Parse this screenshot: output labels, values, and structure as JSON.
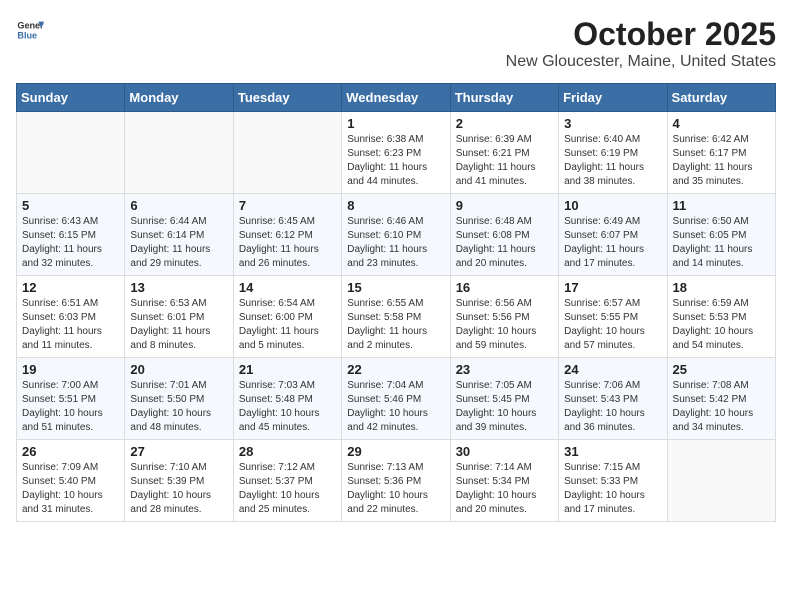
{
  "header": {
    "logo_general": "General",
    "logo_blue": "Blue",
    "title": "October 2025",
    "subtitle": "New Gloucester, Maine, United States"
  },
  "weekdays": [
    "Sunday",
    "Monday",
    "Tuesday",
    "Wednesday",
    "Thursday",
    "Friday",
    "Saturday"
  ],
  "weeks": [
    [
      {
        "day": "",
        "info": ""
      },
      {
        "day": "",
        "info": ""
      },
      {
        "day": "",
        "info": ""
      },
      {
        "day": "1",
        "info": "Sunrise: 6:38 AM\nSunset: 6:23 PM\nDaylight: 11 hours\nand 44 minutes."
      },
      {
        "day": "2",
        "info": "Sunrise: 6:39 AM\nSunset: 6:21 PM\nDaylight: 11 hours\nand 41 minutes."
      },
      {
        "day": "3",
        "info": "Sunrise: 6:40 AM\nSunset: 6:19 PM\nDaylight: 11 hours\nand 38 minutes."
      },
      {
        "day": "4",
        "info": "Sunrise: 6:42 AM\nSunset: 6:17 PM\nDaylight: 11 hours\nand 35 minutes."
      }
    ],
    [
      {
        "day": "5",
        "info": "Sunrise: 6:43 AM\nSunset: 6:15 PM\nDaylight: 11 hours\nand 32 minutes."
      },
      {
        "day": "6",
        "info": "Sunrise: 6:44 AM\nSunset: 6:14 PM\nDaylight: 11 hours\nand 29 minutes."
      },
      {
        "day": "7",
        "info": "Sunrise: 6:45 AM\nSunset: 6:12 PM\nDaylight: 11 hours\nand 26 minutes."
      },
      {
        "day": "8",
        "info": "Sunrise: 6:46 AM\nSunset: 6:10 PM\nDaylight: 11 hours\nand 23 minutes."
      },
      {
        "day": "9",
        "info": "Sunrise: 6:48 AM\nSunset: 6:08 PM\nDaylight: 11 hours\nand 20 minutes."
      },
      {
        "day": "10",
        "info": "Sunrise: 6:49 AM\nSunset: 6:07 PM\nDaylight: 11 hours\nand 17 minutes."
      },
      {
        "day": "11",
        "info": "Sunrise: 6:50 AM\nSunset: 6:05 PM\nDaylight: 11 hours\nand 14 minutes."
      }
    ],
    [
      {
        "day": "12",
        "info": "Sunrise: 6:51 AM\nSunset: 6:03 PM\nDaylight: 11 hours\nand 11 minutes."
      },
      {
        "day": "13",
        "info": "Sunrise: 6:53 AM\nSunset: 6:01 PM\nDaylight: 11 hours\nand 8 minutes."
      },
      {
        "day": "14",
        "info": "Sunrise: 6:54 AM\nSunset: 6:00 PM\nDaylight: 11 hours\nand 5 minutes."
      },
      {
        "day": "15",
        "info": "Sunrise: 6:55 AM\nSunset: 5:58 PM\nDaylight: 11 hours\nand 2 minutes."
      },
      {
        "day": "16",
        "info": "Sunrise: 6:56 AM\nSunset: 5:56 PM\nDaylight: 10 hours\nand 59 minutes."
      },
      {
        "day": "17",
        "info": "Sunrise: 6:57 AM\nSunset: 5:55 PM\nDaylight: 10 hours\nand 57 minutes."
      },
      {
        "day": "18",
        "info": "Sunrise: 6:59 AM\nSunset: 5:53 PM\nDaylight: 10 hours\nand 54 minutes."
      }
    ],
    [
      {
        "day": "19",
        "info": "Sunrise: 7:00 AM\nSunset: 5:51 PM\nDaylight: 10 hours\nand 51 minutes."
      },
      {
        "day": "20",
        "info": "Sunrise: 7:01 AM\nSunset: 5:50 PM\nDaylight: 10 hours\nand 48 minutes."
      },
      {
        "day": "21",
        "info": "Sunrise: 7:03 AM\nSunset: 5:48 PM\nDaylight: 10 hours\nand 45 minutes."
      },
      {
        "day": "22",
        "info": "Sunrise: 7:04 AM\nSunset: 5:46 PM\nDaylight: 10 hours\nand 42 minutes."
      },
      {
        "day": "23",
        "info": "Sunrise: 7:05 AM\nSunset: 5:45 PM\nDaylight: 10 hours\nand 39 minutes."
      },
      {
        "day": "24",
        "info": "Sunrise: 7:06 AM\nSunset: 5:43 PM\nDaylight: 10 hours\nand 36 minutes."
      },
      {
        "day": "25",
        "info": "Sunrise: 7:08 AM\nSunset: 5:42 PM\nDaylight: 10 hours\nand 34 minutes."
      }
    ],
    [
      {
        "day": "26",
        "info": "Sunrise: 7:09 AM\nSunset: 5:40 PM\nDaylight: 10 hours\nand 31 minutes."
      },
      {
        "day": "27",
        "info": "Sunrise: 7:10 AM\nSunset: 5:39 PM\nDaylight: 10 hours\nand 28 minutes."
      },
      {
        "day": "28",
        "info": "Sunrise: 7:12 AM\nSunset: 5:37 PM\nDaylight: 10 hours\nand 25 minutes."
      },
      {
        "day": "29",
        "info": "Sunrise: 7:13 AM\nSunset: 5:36 PM\nDaylight: 10 hours\nand 22 minutes."
      },
      {
        "day": "30",
        "info": "Sunrise: 7:14 AM\nSunset: 5:34 PM\nDaylight: 10 hours\nand 20 minutes."
      },
      {
        "day": "31",
        "info": "Sunrise: 7:15 AM\nSunset: 5:33 PM\nDaylight: 10 hours\nand 17 minutes."
      },
      {
        "day": "",
        "info": ""
      }
    ]
  ]
}
